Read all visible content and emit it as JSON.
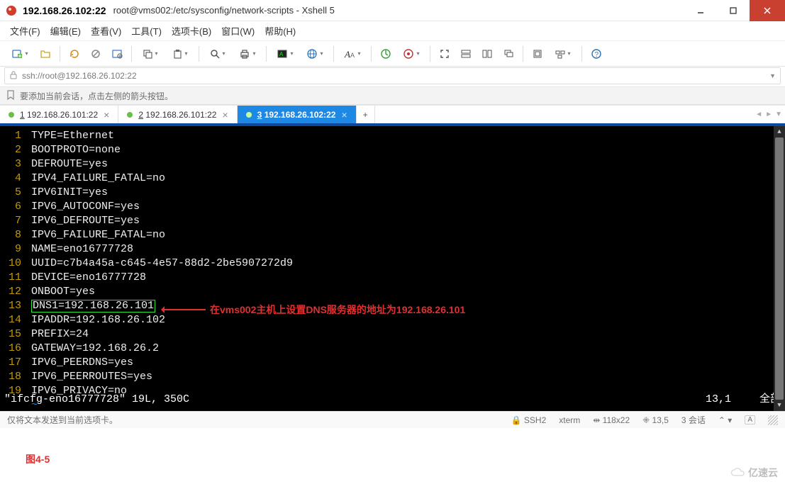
{
  "titlebar": {
    "addr": "192.168.26.102:22",
    "path": "root@vms002:/etc/sysconfig/network-scripts - Xshell 5"
  },
  "menu": {
    "file": "文件(F)",
    "edit": "编辑(E)",
    "view": "查看(V)",
    "tools": "工具(T)",
    "tab": "选项卡(B)",
    "window": "窗口(W)",
    "help": "帮助(H)"
  },
  "addressbar": {
    "value": "ssh://root@192.168.26.102:22"
  },
  "hint": {
    "text": "要添加当前会话，点击左侧的箭头按钮。"
  },
  "tabs": [
    {
      "accel": "1",
      "label": "192.168.26.101:22",
      "active": false
    },
    {
      "accel": "2",
      "label": "192.168.26.101:22",
      "active": false
    },
    {
      "accel": "3",
      "label": "192.168.26.102:22",
      "active": true
    }
  ],
  "editor": {
    "lines": [
      "TYPE=Ethernet",
      "BOOTPROTO=none",
      "DEFROUTE=yes",
      "IPV4_FAILURE_FATAL=no",
      "IPV6INIT=yes",
      "IPV6_AUTOCONF=yes",
      "IPV6_DEFROUTE=yes",
      "IPV6_FAILURE_FATAL=no",
      "NAME=eno16777728",
      "UUID=c7b4a45a-c645-4e57-88d2-2be5907272d9",
      "DEVICE=eno16777728",
      "ONBOOT=yes",
      "DNS1=192.168.26.101",
      "IPADDR=192.168.26.102",
      "PREFIX=24",
      "GATEWAY=192.168.26.2",
      "IPV6_PEERDNS=yes",
      "IPV6_PEERROUTES=yes",
      "IPV6_PRIVACY=no"
    ],
    "highlight_line_index": 12,
    "status_file": "\"ifcfg-eno16777728\" 19L, 350C",
    "status_pos": "13,1",
    "status_scroll": "全部"
  },
  "annotation": {
    "text": "在vms002主机上设置DNS服务器的地址为192.168.26.101"
  },
  "figure_caption": "图4-5",
  "statusbar": {
    "left": "仅将文本发送到当前选项卡。",
    "ssh": "SSH2",
    "term": "xterm",
    "size": "118x22",
    "pos": "13,5",
    "sessions": "3 会话",
    "icon_label": "⌃"
  },
  "watermark": "亿速云"
}
